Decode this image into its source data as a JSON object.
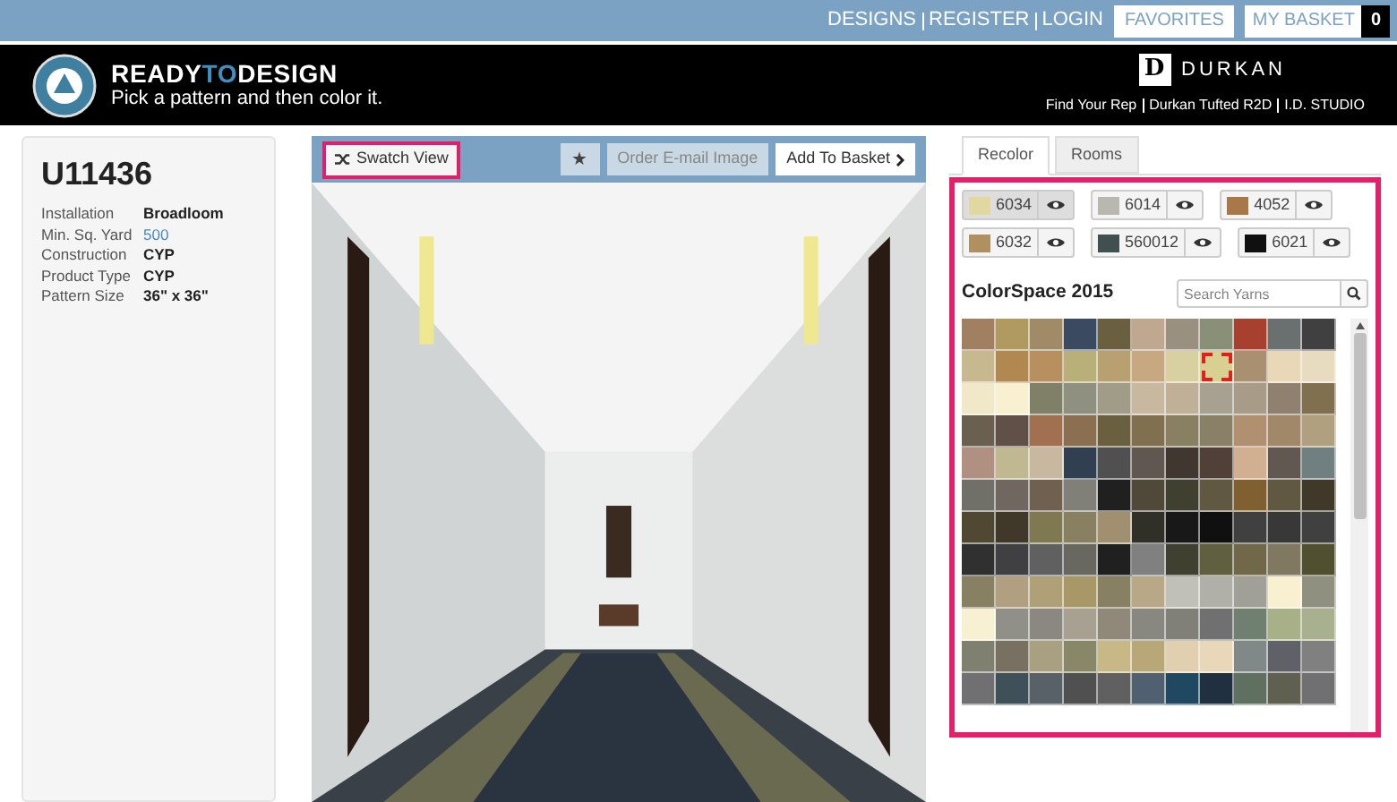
{
  "top_bar": {
    "links": [
      "DESIGNS",
      "REGISTER",
      "LOGIN"
    ],
    "favorites": "FAVORITES",
    "basket": "MY BASKET",
    "basket_count": "0"
  },
  "header": {
    "brand_parts": [
      "READY",
      "TO",
      "DESIGN"
    ],
    "tagline": "Pick a pattern and then color it.",
    "partner": "DURKAN",
    "partner_mark": "D",
    "partner_links": [
      "Find Your Rep",
      "Durkan Tufted R2D",
      "I.D. STUDIO"
    ]
  },
  "product": {
    "code": "U11436",
    "specs": [
      {
        "label": "Installation",
        "value": "Broadloom",
        "kind": "text"
      },
      {
        "label": "Min. Sq. Yard",
        "value": "500",
        "kind": "link"
      },
      {
        "label": "Construction",
        "value": "CYP",
        "kind": "text"
      },
      {
        "label": "Product Type",
        "value": "CYP",
        "kind": "text"
      },
      {
        "label": "Pattern Size",
        "value": "36\" x 36\"",
        "kind": "text"
      }
    ]
  },
  "viewer": {
    "swatch_view": "Swatch View",
    "star": "★",
    "order_image": "Order E-mail Image",
    "add_to_basket": "Add To Basket"
  },
  "tabs": [
    {
      "label": "Recolor",
      "selected": true
    },
    {
      "label": "Rooms",
      "selected": false
    }
  ],
  "chips": [
    {
      "code": "6034",
      "color": "#e0d8a0",
      "selected": true
    },
    {
      "code": "6014",
      "color": "#b8b8b0",
      "selected": false
    },
    {
      "code": "4052",
      "color": "#a87848",
      "selected": false
    },
    {
      "code": "6032",
      "color": "#b09060",
      "selected": false
    },
    {
      "code": "560012",
      "color": "#405050",
      "selected": false
    },
    {
      "code": "6021",
      "color": "#101010",
      "selected": false
    }
  ],
  "palette": {
    "title": "ColorSpace 2015",
    "search_placeholder": "Search Yarns",
    "rows": [
      {
        "cells": [
          {
            "color": "#a08060",
            "selected": false
          },
          {
            "color": "#b09a60",
            "selected": false
          },
          {
            "color": "#a08a68",
            "selected": false
          },
          {
            "color": "#3a4a60",
            "selected": false
          },
          {
            "color": "#6a6040",
            "selected": false
          },
          {
            "color": "#c0a890",
            "selected": false
          },
          {
            "color": "#9a9080",
            "selected": false
          },
          {
            "color": "#8a9078",
            "selected": false
          },
          {
            "color": "#a84030",
            "selected": false
          },
          {
            "color": "#6a7070",
            "selected": false
          },
          {
            "color": "#404040",
            "selected": false
          }
        ]
      },
      {
        "cells": [
          {
            "color": "#c8b890",
            "selected": false
          },
          {
            "color": "#b08850",
            "selected": false
          },
          {
            "color": "#b89060",
            "selected": false
          },
          {
            "color": "#b8b078",
            "selected": false
          },
          {
            "color": "#b8a070",
            "selected": false
          },
          {
            "color": "#c8a880",
            "selected": false
          },
          {
            "color": "#d8d0a0",
            "selected": false
          },
          {
            "color": "#d8d090",
            "selected": true
          },
          {
            "color": "#a89070",
            "selected": false
          },
          {
            "color": "#e8d8b8",
            "selected": false
          },
          {
            "color": "#e8dcc0",
            "selected": false
          }
        ]
      },
      {
        "cells": [
          {
            "color": "#f0e8c8",
            "selected": false
          },
          {
            "color": "#f8f0d0",
            "selected": false
          },
          {
            "color": "#808068",
            "selected": false
          },
          {
            "color": "#909080",
            "selected": false
          },
          {
            "color": "#a09c88",
            "selected": false
          },
          {
            "color": "#c8b8a0",
            "selected": false
          },
          {
            "color": "#c0b098",
            "selected": false
          },
          {
            "color": "#a8a090",
            "selected": false
          },
          {
            "color": "#a89c88",
            "selected": false
          },
          {
            "color": "#908070",
            "selected": false
          },
          {
            "color": "#807050",
            "selected": false
          }
        ]
      },
      {
        "cells": [
          {
            "color": "#6a6050",
            "selected": false
          },
          {
            "color": "#605048",
            "selected": false
          },
          {
            "color": "#a07050",
            "selected": false
          },
          {
            "color": "#8a7050",
            "selected": false
          },
          {
            "color": "#6a6040",
            "selected": false
          },
          {
            "color": "#807050",
            "selected": false
          },
          {
            "color": "#888060",
            "selected": false
          },
          {
            "color": "#8a8068",
            "selected": false
          },
          {
            "color": "#b09070",
            "selected": false
          },
          {
            "color": "#a08868",
            "selected": false
          },
          {
            "color": "#b0a080",
            "selected": false
          }
        ]
      },
      {
        "cells": [
          {
            "color": "#b09080",
            "selected": false
          },
          {
            "color": "#c0b890",
            "selected": false
          },
          {
            "color": "#c8b8a0",
            "selected": false
          },
          {
            "color": "#304050",
            "selected": false
          },
          {
            "color": "#505050",
            "selected": false
          },
          {
            "color": "#605850",
            "selected": false
          },
          {
            "color": "#403830",
            "selected": false
          },
          {
            "color": "#504038",
            "selected": false
          },
          {
            "color": "#d0b090",
            "selected": false
          },
          {
            "color": "#605851",
            "selected": false
          },
          {
            "color": "#708080",
            "selected": false
          }
        ]
      },
      {
        "cells": [
          {
            "color": "#707068",
            "selected": false
          },
          {
            "color": "#706860",
            "selected": false
          },
          {
            "color": "#706050",
            "selected": false
          },
          {
            "color": "#808078",
            "selected": false
          },
          {
            "color": "#202020",
            "selected": false
          },
          {
            "color": "#504838",
            "selected": false
          },
          {
            "color": "#404030",
            "selected": false
          },
          {
            "color": "#605840",
            "selected": false
          },
          {
            "color": "#806030",
            "selected": false
          },
          {
            "color": "#605841",
            "selected": false
          },
          {
            "color": "#403828",
            "selected": false
          }
        ]
      },
      {
        "cells": [
          {
            "color": "#504830",
            "selected": false
          },
          {
            "color": "#403829",
            "selected": false
          },
          {
            "color": "#807850",
            "selected": false
          },
          {
            "color": "#888061",
            "selected": false
          },
          {
            "color": "#a09070",
            "selected": false
          },
          {
            "color": "#303028",
            "selected": false
          },
          {
            "color": "#181818",
            "selected": false
          },
          {
            "color": "#101010",
            "selected": false
          },
          {
            "color": "#404040",
            "selected": false
          },
          {
            "color": "#383838",
            "selected": false
          },
          {
            "color": "#404041",
            "selected": false
          }
        ]
      },
      {
        "cells": [
          {
            "color": "#303030",
            "selected": false
          },
          {
            "color": "#404042",
            "selected": false
          },
          {
            "color": "#606060",
            "selected": false
          },
          {
            "color": "#686860",
            "selected": false
          },
          {
            "color": "#202021",
            "selected": false
          },
          {
            "color": "#808080",
            "selected": false
          },
          {
            "color": "#404030",
            "selected": false
          },
          {
            "color": "#606040",
            "selected": false
          },
          {
            "color": "#706848",
            "selected": false
          },
          {
            "color": "#807860",
            "selected": false
          },
          {
            "color": "#505030",
            "selected": false
          }
        ]
      },
      {
        "cells": [
          {
            "color": "#888062",
            "selected": false
          },
          {
            "color": "#b0a081",
            "selected": false
          },
          {
            "color": "#b0a078",
            "selected": false
          },
          {
            "color": "#a89868",
            "selected": false
          },
          {
            "color": "#888063",
            "selected": false
          },
          {
            "color": "#b8a888",
            "selected": false
          },
          {
            "color": "#c0c0b8",
            "selected": false
          },
          {
            "color": "#b0b0a8",
            "selected": false
          },
          {
            "color": "#a0a098",
            "selected": false
          },
          {
            "color": "#f8f0d1",
            "selected": false
          },
          {
            "color": "#909081",
            "selected": false
          }
        ]
      },
      {
        "cells": [
          {
            "color": "#f8f0d2",
            "selected": false
          },
          {
            "color": "#909088",
            "selected": false
          },
          {
            "color": "#8a8880",
            "selected": false
          },
          {
            "color": "#a8a091",
            "selected": false
          },
          {
            "color": "#908878",
            "selected": false
          },
          {
            "color": "#888880",
            "selected": false
          },
          {
            "color": "#808079",
            "selected": false
          },
          {
            "color": "#707071",
            "selected": false
          },
          {
            "color": "#708070",
            "selected": false
          },
          {
            "color": "#a8b088",
            "selected": false
          },
          {
            "color": "#a8b090",
            "selected": false
          }
        ]
      },
      {
        "cells": [
          {
            "color": "#808070",
            "selected": false
          },
          {
            "color": "#787060",
            "selected": false
          },
          {
            "color": "#a8a080",
            "selected": false
          },
          {
            "color": "#888868",
            "selected": false
          },
          {
            "color": "#c8b888",
            "selected": false
          },
          {
            "color": "#b8a878",
            "selected": false
          },
          {
            "color": "#e0d0b0",
            "selected": false
          },
          {
            "color": "#e8d8b9",
            "selected": false
          },
          {
            "color": "#808888",
            "selected": false
          },
          {
            "color": "#606068",
            "selected": false
          },
          {
            "color": "#808081",
            "selected": false
          }
        ]
      },
      {
        "cells": [
          {
            "color": "#707072",
            "selected": false
          },
          {
            "color": "#405058",
            "selected": false
          },
          {
            "color": "#586068",
            "selected": false
          },
          {
            "color": "#505051",
            "selected": false
          },
          {
            "color": "#606061",
            "selected": false
          },
          {
            "color": "#506070",
            "selected": false
          },
          {
            "color": "#204860",
            "selected": false
          },
          {
            "color": "#203040",
            "selected": false
          },
          {
            "color": "#607060",
            "selected": false
          },
          {
            "color": "#606050",
            "selected": false
          },
          {
            "color": "#707073",
            "selected": false
          }
        ]
      }
    ]
  }
}
